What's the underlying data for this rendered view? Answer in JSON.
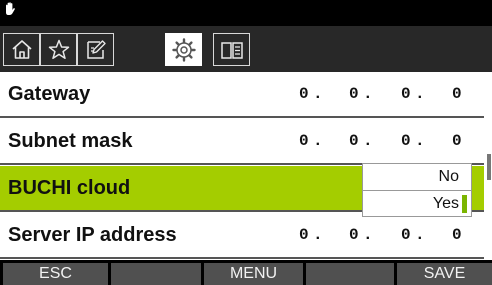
{
  "status_bar": {
    "icon": "hand-icon"
  },
  "tabs": [
    {
      "icon": "home-icon",
      "active": false
    },
    {
      "icon": "star-icon",
      "active": false
    },
    {
      "icon": "edit-icon",
      "active": false
    },
    {
      "icon": "gear-icon",
      "active": true
    },
    {
      "icon": "book-icon",
      "active": false
    }
  ],
  "rows": [
    {
      "label": "Gateway",
      "octets": [
        "0",
        "0",
        "0",
        "0"
      ]
    },
    {
      "label": "Subnet mask",
      "octets": [
        "0",
        "0",
        "0",
        "0"
      ]
    },
    {
      "label": "BUCHI cloud",
      "selected": true
    },
    {
      "label": "Server IP address",
      "octets": [
        "0",
        "0",
        "0",
        "0"
      ]
    }
  ],
  "dropdown": {
    "options": [
      "No",
      "Yes"
    ],
    "selected_value": "Yes"
  },
  "soft_keys": {
    "esc": "ESC",
    "menu": "MENU",
    "save": "SAVE"
  },
  "colors": {
    "accent": "#a4cd00",
    "marker": "#7bb500",
    "key_bg": "#505050",
    "tab_bar_bg": "#282828"
  }
}
